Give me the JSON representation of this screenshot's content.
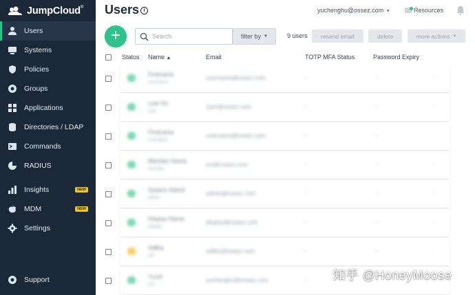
{
  "app": {
    "logo_text": "JumpCloud",
    "logo_reg": "®",
    "accent_color": "#2fc28c",
    "sidebar_bg": "#1b2838"
  },
  "sidebar": {
    "items": [
      {
        "label": "Users",
        "icon": "users-icon",
        "active": true
      },
      {
        "label": "Systems",
        "icon": "systems-icon"
      },
      {
        "label": "Policies",
        "icon": "shield-icon"
      },
      {
        "label": "Groups",
        "icon": "groups-icon"
      },
      {
        "label": "Applications",
        "icon": "applications-icon"
      },
      {
        "label": "Directories / LDAP",
        "icon": "directories-icon"
      },
      {
        "label": "Commands",
        "icon": "terminal-icon"
      },
      {
        "label": "RADIUS",
        "icon": "radius-icon"
      },
      {
        "label": "Insights",
        "icon": "insights-icon",
        "badge": "NEW"
      },
      {
        "label": "MDM",
        "icon": "apple-icon",
        "badge": "NEW"
      },
      {
        "label": "Settings",
        "icon": "gear-icon"
      },
      {
        "label": "Support",
        "icon": "support-icon"
      }
    ]
  },
  "header": {
    "title": "Users",
    "user_email": "yuchenghu@ossez.com",
    "resources_label": "Resources"
  },
  "toolbar": {
    "search_placeholder": "Search",
    "filter_label": "filter by",
    "user_count": "9 users",
    "resend_label": "resend email",
    "delete_label": "delete",
    "more_label": "more actions"
  },
  "table": {
    "columns": {
      "status": "Status",
      "name": "Name",
      "email": "Email",
      "totp": "TOTP MFA Status",
      "expiry": "Password Expiry"
    },
    "rows": [
      {
        "status_color": "#7fd9b5",
        "name": "Firstname",
        "sub": "username",
        "email": "username@ossez.com"
      },
      {
        "status_color": "#7fd9b5",
        "name": "Last Ho",
        "sub": "user",
        "email": "user@ossez.com"
      },
      {
        "status_color": "#7fd9b5",
        "name": "Firstname",
        "sub": "username",
        "email": "username@ossez.com"
      },
      {
        "status_color": "#7fd9b5",
        "name": "Member Name",
        "sub": "member",
        "email": "me@ossez.com"
      },
      {
        "status_color": "#7fd9b5",
        "name": "System Admin",
        "sub": "admin",
        "email": "admin@ossez.com"
      },
      {
        "status_color": "#7fd9b5",
        "name": "Display Name",
        "sub": "display",
        "email": "display@ossez.com"
      },
      {
        "status_color": "#f9cf6a",
        "name": "Adlibs",
        "sub": "adl",
        "email": "adlibs@ossez.com"
      },
      {
        "status_color": "#7fd9b5",
        "name": "Yucel",
        "sub": "yuc",
        "email": "yuchenghu@ossez.com"
      }
    ]
  },
  "watermark": "知乎 @HoneyMoose"
}
